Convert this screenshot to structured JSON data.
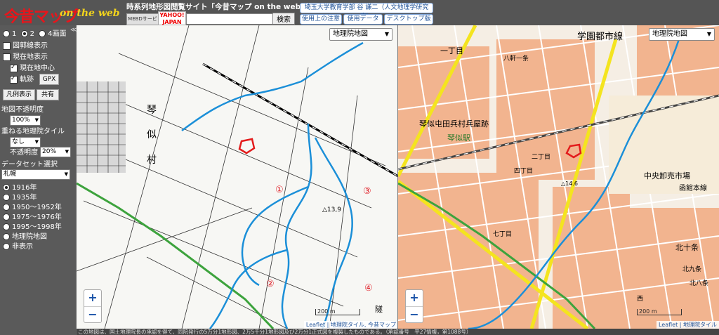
{
  "header": {
    "logo_text": "今昔マップ",
    "logo_sub": "on the web",
    "site_title": "時系列地形図閲覧サイト「今昔マップ on the web」",
    "search_badge": "MEBDサービス",
    "yahoo_badge": "YAHOO! JAPAN",
    "search_value": "",
    "search_button": "検索",
    "links": [
      "埼玉大学教育学部 谷 謙二（人文地理学研究室）",
      "使用上の注意",
      "使用データ",
      "デスクトップ版"
    ]
  },
  "sidebar": {
    "screen_modes": [
      "1",
      "2",
      "4画面"
    ],
    "screen_mode_selected": "2",
    "show_index": "図郭線表示",
    "show_location": "現在地表示",
    "current_center": "現在地中心",
    "track": "軌跡",
    "gpx_button": "GPX",
    "legend_button": "凡例表示",
    "share_button": "共有",
    "opacity_label": "地図不透明度",
    "opacity_value": "100%",
    "overlay_label": "重ねる地理院タイル",
    "overlay_value": "なし",
    "overlay_opacity_label": "不透明度",
    "overlay_opacity_value": "20%",
    "dataset_label": "データセット選択",
    "dataset_value": "札幌",
    "periods": [
      "1916年",
      "1935年",
      "1950～1952年",
      "1975～1976年",
      "1995～1998年",
      "地理院地図",
      "非表示"
    ],
    "period_selected": "1916年"
  },
  "map_left": {
    "layer_select": "地理院地図",
    "labels": {
      "kotoni1": "琴",
      "kotoni2": "似",
      "kotoni3": "村",
      "elev": "△13,9",
      "n1": "①",
      "n2": "②",
      "n3": "③",
      "n4": "④",
      "cut": "隧"
    },
    "scale": "200 m",
    "attribution": "Leaflet | 地理院タイル, 今昔マップ"
  },
  "map_right": {
    "layer_select": "地理院地図",
    "labels": {
      "heioku": "琴似屯田兵村兵屋跡",
      "kotoni_station": "琴似駅",
      "market": "中央卸売市場",
      "gakuen": "学園都市線",
      "ittyome": "一丁目",
      "nicho": "二丁目",
      "yonchome": "四丁目",
      "nanachome": "七丁目",
      "hachiken": "八軒一条",
      "kita10": "北十条",
      "kita9": "北九条",
      "kita8": "北八条",
      "nishi": "西",
      "sapporo_line": "函館本線",
      "elev": "△14.6"
    },
    "scale": "200 m",
    "attribution": "Leaflet | 地理院タイル"
  },
  "footer": "この地図は、国土地理院長の承認を得て、同院発行の5万分1地形図、2万5千分1地形図及び2万分1正式図を複製したものである。（承認番号　平27情複，第1088号）",
  "colors": {
    "river": "#1b8fd8",
    "route_red": "#e31c1c",
    "road_yellow": "#f4e41f",
    "rail_green": "#3da33d"
  }
}
